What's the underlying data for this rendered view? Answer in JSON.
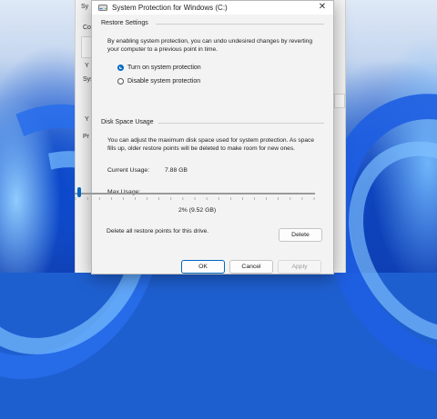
{
  "dialog": {
    "title": "System Protection for Windows (C:)",
    "close_glyph": "✕",
    "restore_settings": {
      "heading": "Restore Settings",
      "description": "By enabling system protection, you can undo undesired changes by reverting your computer to a previous point in time.",
      "options": [
        {
          "label": "Turn on system protection",
          "selected": true
        },
        {
          "label": "Disable system protection",
          "selected": false
        }
      ]
    },
    "disk_space": {
      "heading": "Disk Space Usage",
      "description": "You can adjust the maximum disk space used for system protection. As space fills up, older restore points will be deleted to make room for new ones.",
      "current_usage_label": "Current Usage:",
      "current_usage_value": "7.88 GB",
      "max_usage_label": "Max Usage:",
      "max_usage_fraction": 0.02,
      "max_usage_caption": "2% (9.52 GB)",
      "delete_text": "Delete all restore points for this drive.",
      "delete_label": "Delete"
    },
    "footer": {
      "ok_label": "OK",
      "cancel_label": "Cancel",
      "apply_label": "Apply"
    },
    "accent_color": "#0067c0"
  },
  "background_window": {
    "visible_fragments": [
      "Sy",
      "Com",
      "Y",
      "Sys",
      "Y",
      "Pr"
    ]
  }
}
